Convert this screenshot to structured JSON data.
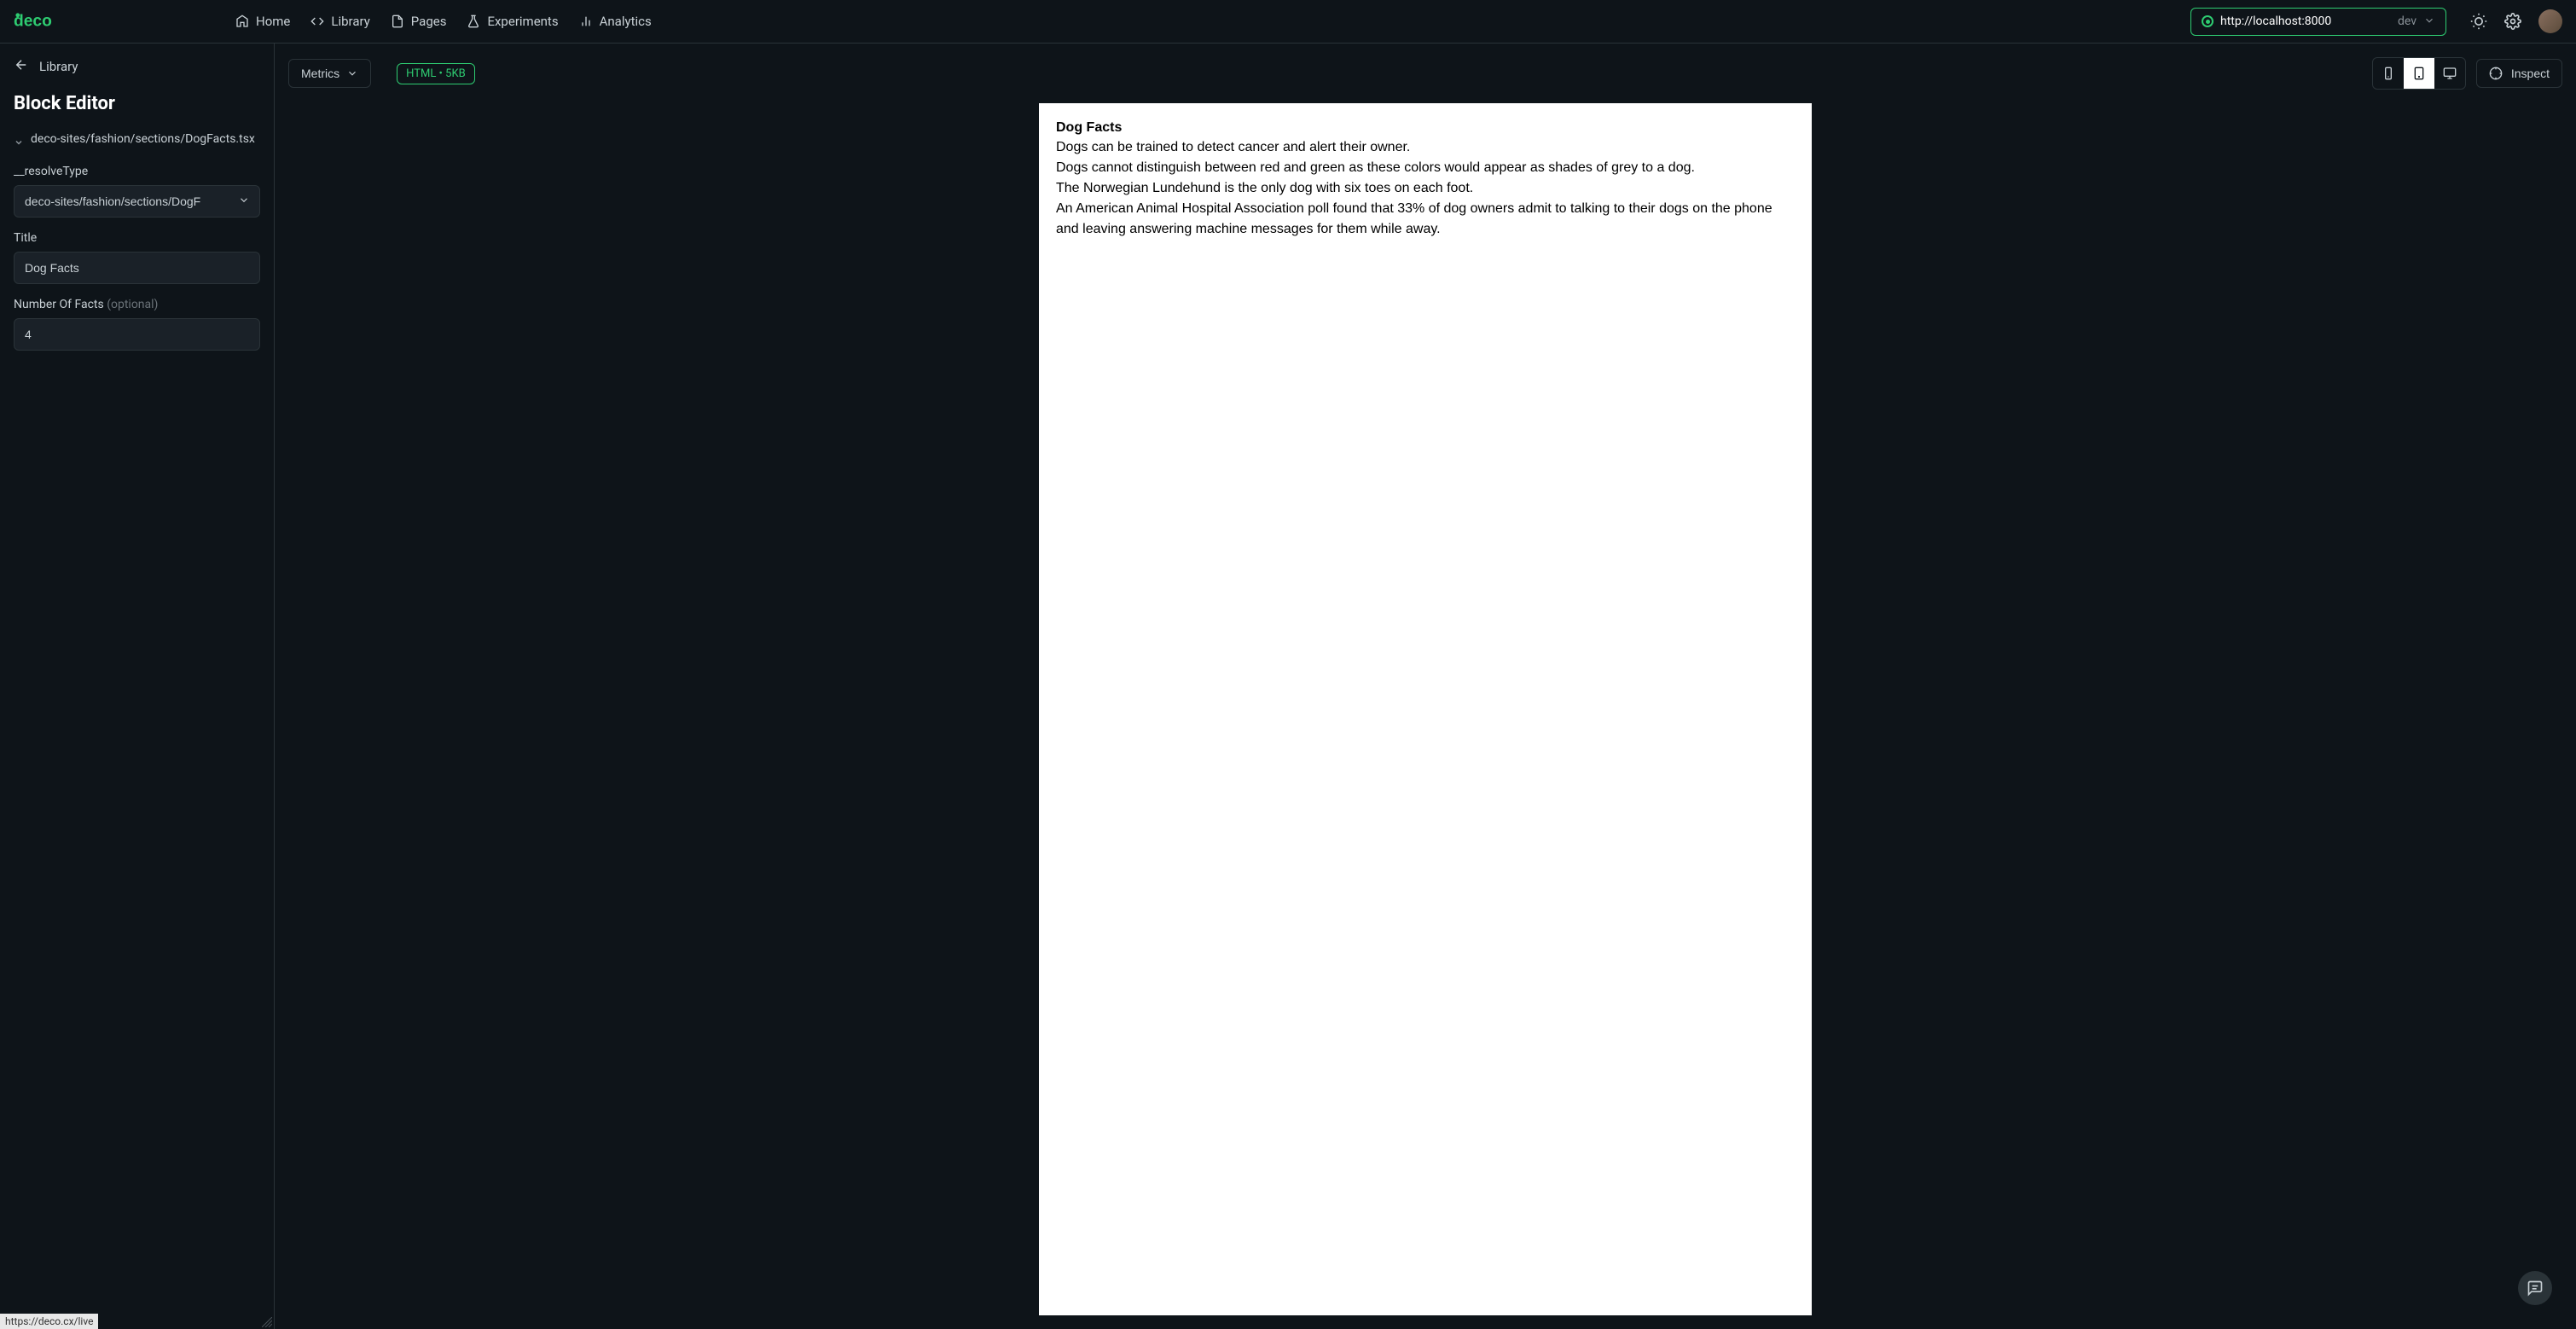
{
  "logo": "deco",
  "nav": {
    "home": "Home",
    "library": "Library",
    "pages": "Pages",
    "experiments": "Experiments",
    "analytics": "Analytics"
  },
  "urlBar": {
    "url": "http://localhost:8000",
    "env": "dev"
  },
  "sidebar": {
    "back": "Library",
    "title": "Block Editor",
    "treeItem": "deco-sites/fashion/sections/DogFacts.tsx",
    "resolveTypeLabel": "__resolveType",
    "resolveTypeValue": "deco-sites/fashion/sections/DogF",
    "titleLabel": "Title",
    "titleValue": "Dog Facts",
    "numFactsLabel": "Number Of Facts",
    "numFactsOptional": "(optional)",
    "numFactsValue": "4"
  },
  "toolbar": {
    "metrics": "Metrics",
    "htmlBadge": "HTML • 5KB",
    "inspect": "Inspect"
  },
  "preview": {
    "title": "Dog Facts",
    "facts": [
      "Dogs can be trained to detect cancer and alert their owner.",
      "Dogs cannot distinguish between red and green as these colors would appear as shades of grey to a dog.",
      "The Norwegian Lundehund is the only dog with six toes on each foot.",
      "An American Animal Hospital Association poll found that 33% of dog owners admit to talking to their dogs on the phone and leaving answering machine messages for them while away."
    ]
  },
  "statusUrl": "https://deco.cx/live"
}
